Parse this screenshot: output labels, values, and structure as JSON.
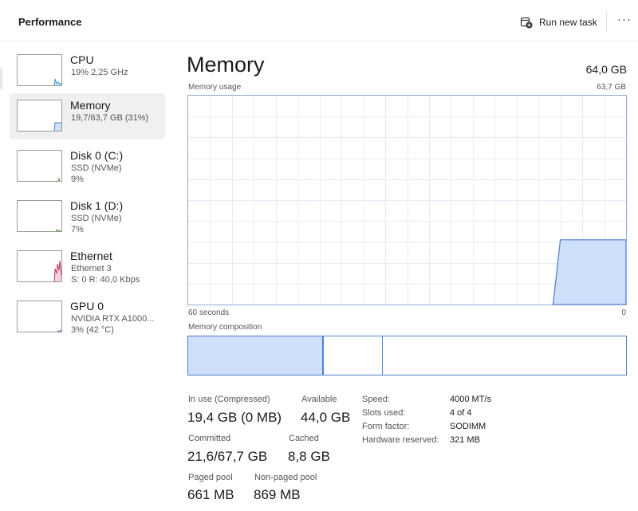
{
  "header": {
    "title": "Performance",
    "run_new_task_label": "Run new task",
    "more_label": "···"
  },
  "sidebar": {
    "items": [
      {
        "name": "CPU",
        "lines": [
          "19% 2,25 GHz"
        ],
        "graph_color": "#3d8fd1",
        "graph_fill": "#d6ecfa",
        "icon": "cpu-graph-icon"
      },
      {
        "name": "Memory",
        "lines": [
          "19,7/63,7 GB (31%)"
        ],
        "graph_color": "#4f7fd0",
        "graph_fill": "#cddff9",
        "icon": "memory-graph-icon"
      },
      {
        "name": "Disk 0 (C:)",
        "lines": [
          "SSD (NVMe)",
          "9%"
        ],
        "graph_color": "#4a9a35",
        "graph_fill": "#d8efd0",
        "icon": "disk-graph-icon"
      },
      {
        "name": "Disk 1 (D:)",
        "lines": [
          "SSD (NVMe)",
          "7%"
        ],
        "graph_color": "#4a9a35",
        "graph_fill": "#d8efd0",
        "icon": "disk-graph-icon"
      },
      {
        "name": "Ethernet",
        "lines": [
          "Ethernet 3",
          "S: 0 R: 40,0 Kbps"
        ],
        "graph_color": "#b73b6a",
        "graph_fill": "#f3d1de",
        "icon": "ethernet-graph-icon"
      },
      {
        "name": "GPU 0",
        "lines": [
          "NVIDIA RTX A1000...",
          "3% (42 °C)"
        ],
        "graph_color": "#8a3fc0",
        "graph_fill": "#e6d3f3",
        "icon": "gpu-graph-icon"
      }
    ]
  },
  "main": {
    "title": "Memory",
    "total": "64,0 GB",
    "usage_label": "Memory usage",
    "usage_max": "63,7 GB",
    "x_left": "60 seconds",
    "x_right": "0",
    "composition_label": "Memory composition",
    "composition": {
      "in_use_fraction": 0.31,
      "modified_fraction": 0.135
    },
    "stats": {
      "in_use_label": "In use (Compressed)",
      "in_use_value": "19,4 GB (0 MB)",
      "available_label": "Available",
      "available_value": "44,0 GB",
      "committed_label": "Committed",
      "committed_value": "21,6/67,7 GB",
      "cached_label": "Cached",
      "cached_value": "8,8 GB",
      "paged_label": "Paged pool",
      "paged_value": "661 MB",
      "nonpaged_label": "Non-paged pool",
      "nonpaged_value": "869 MB"
    },
    "info": [
      {
        "key": "Speed:",
        "value": "4000 MT/s"
      },
      {
        "key": "Slots used:",
        "value": "4 of 4"
      },
      {
        "key": "Form factor:",
        "value": "SODIMM"
      },
      {
        "key": "Hardware reserved:",
        "value": "321 MB"
      }
    ],
    "usage_history_percent": [
      0,
      0,
      0,
      0,
      0,
      0,
      0,
      0,
      0,
      0,
      0,
      0,
      0,
      0,
      0,
      0,
      0,
      0,
      0,
      0,
      0,
      0,
      0,
      0,
      0,
      0,
      0,
      0,
      0,
      0,
      0,
      0,
      0,
      0,
      0,
      0,
      0,
      0,
      0,
      0,
      0,
      0,
      0,
      0,
      0,
      0,
      0,
      0,
      0,
      0,
      0,
      31,
      31,
      31,
      31,
      31,
      31,
      31,
      31,
      31,
      31
    ],
    "graph_color": "#4f7fd0",
    "graph_fill": "#cddff9",
    "grid_color": "#e6ecf5"
  }
}
